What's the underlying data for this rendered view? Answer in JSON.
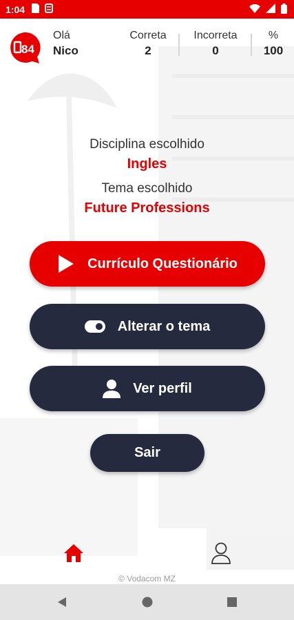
{
  "status_bar": {
    "time": "1:04",
    "icons": [
      "sim-card-icon",
      "sync-icon",
      "wifi-icon",
      "signal-icon",
      "battery-icon"
    ]
  },
  "header": {
    "logo_text": "84",
    "greeting": "Olá",
    "user_name": "Nico",
    "stats": {
      "correct_label": "Correta",
      "correct_value": "2",
      "incorrect_label": "Incorreta",
      "incorrect_value": "0",
      "percent_label": "%",
      "percent_value": "100"
    }
  },
  "selection": {
    "discipline_label": "Disciplina escolhido",
    "discipline_value": "Ingles",
    "theme_label": "Tema escolhido",
    "theme_value": "Future Professions"
  },
  "buttons": {
    "quiz": "Currículo Questionário",
    "change_theme": "Alterar o tema",
    "view_profile": "Ver perfil",
    "exit": "Sair"
  },
  "bottom_nav": {
    "items": [
      "home-icon",
      "profile-icon"
    ],
    "active": "home-icon"
  },
  "footer": {
    "copyright": "© Vodacom MZ"
  },
  "colors": {
    "accent": "#e60000",
    "dark_button": "#262a3f",
    "nav_bar": "#e4e4e4"
  }
}
